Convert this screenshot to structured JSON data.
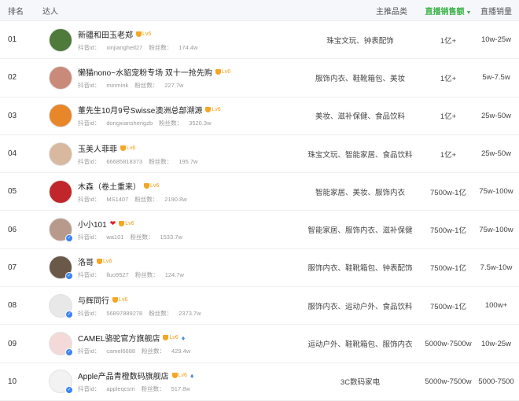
{
  "header": {
    "rank": "排名",
    "kol": "达人",
    "category": "主推品类",
    "sales": "直播销售额",
    "volume": "直播销量",
    "sales_arrow": "▼"
  },
  "labels": {
    "douyin_id": "抖音id：",
    "fans": "粉丝数："
  },
  "colors": {
    "accent": "#3cb34a",
    "level": "#f5a623",
    "heart": "#e0202a"
  },
  "rows": [
    {
      "rank": "01",
      "name": "新疆和田玉老郑",
      "level": "Lv6",
      "id": "xinjianghetl27",
      "fans": "174.4w",
      "category": "珠宝文玩、钟表配饰",
      "sales": "1亿+",
      "volume": "10w-25w",
      "avatar_color": "#4e7a3c"
    },
    {
      "rank": "02",
      "name": "懒猫nono~水貂宠粉专场 双十一抢先购",
      "level": "Lv6",
      "id": "minmink",
      "fans": "227.7w",
      "category": "服饰内衣、鞋靴箱包、美妆",
      "sales": "1亿+",
      "volume": "5w-7.5w",
      "avatar_color": "#c98a7a"
    },
    {
      "rank": "03",
      "name": "董先生10月9号Swisse澳洲总部溯源",
      "level": "Lv6",
      "id": "dongxianshengzb",
      "fans": "3520.3w",
      "category": "美妆、滋补保健、食品饮料",
      "sales": "1亿+",
      "volume": "25w-50w",
      "avatar_color": "#e8862a"
    },
    {
      "rank": "04",
      "name": "玉美人菲菲",
      "level": "Lv6",
      "id": "66685818373",
      "fans": "195.7w",
      "category": "珠宝文玩、智能家居、食品饮料",
      "sales": "1亿+",
      "volume": "25w-50w",
      "avatar_color": "#d9b8a0"
    },
    {
      "rank": "05",
      "name": "木森（卷土重来）",
      "level": "Lv6",
      "id": "MS1407",
      "fans": "2190.8w",
      "category": "智能家居、美妆、服饰内衣",
      "sales": "7500w-1亿",
      "volume": "75w-100w",
      "avatar_color": "#c0262b"
    },
    {
      "rank": "06",
      "name": "小小101",
      "heart": "❤",
      "level": "Lv6",
      "id": "wa101",
      "fans": "1533.7w",
      "category": "智能家居、服饰内衣、滋补保健",
      "sales": "7500w-1亿",
      "volume": "75w-100w",
      "avatar_color": "#b89a8c"
    },
    {
      "rank": "07",
      "name": "洛哥",
      "level": "Lv6",
      "id": "lluo9527",
      "fans": "124.7w",
      "category": "服饰内衣、鞋靴箱包、钟表配饰",
      "sales": "7500w-1亿",
      "volume": "7.5w-10w",
      "avatar_color": "#6a5848"
    },
    {
      "rank": "08",
      "name": "与辉同行",
      "level": "Lv6",
      "id": "56897889278",
      "fans": "2373.7w",
      "category": "服饰内衣、运动户外、食品饮料",
      "sales": "7500w-1亿",
      "volume": "100w+",
      "avatar_color": "#e8e8e8"
    },
    {
      "rank": "09",
      "name": "CAMEL骆驼官方旗舰店",
      "level": "Lv6",
      "id": "camel6688",
      "fans": "429.4w",
      "category": "运动户外、鞋靴箱包、服饰内衣",
      "sales": "5000w-7500w",
      "volume": "10w-25w",
      "avatar_color": "#f4d9d9",
      "brand": "♦"
    },
    {
      "rank": "10",
      "name": "Apple产品青橙数码旗舰店",
      "level": "Lv6",
      "id": "appleqcsm",
      "fans": "517.8w",
      "category": "3C数码家电",
      "sales": "5000w-7500w",
      "volume": "5000-7500",
      "avatar_color": "#f2f2f2",
      "brand": "♦"
    }
  ]
}
